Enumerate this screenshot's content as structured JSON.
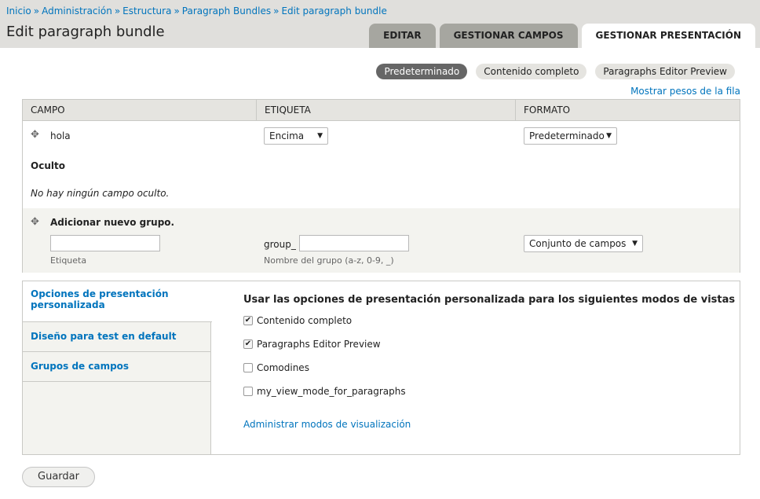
{
  "breadcrumb": [
    "Inicio",
    "Administración",
    "Estructura",
    "Paragraph Bundles",
    "Edit paragraph bundle"
  ],
  "breadcrumb_separator": "»",
  "page_title": "Edit paragraph bundle",
  "tabs": [
    {
      "label": "EDITAR",
      "active": false
    },
    {
      "label": "GESTIONAR CAMPOS",
      "active": false
    },
    {
      "label": "GESTIONAR PRESENTACIÓN",
      "active": true
    }
  ],
  "view_modes": [
    {
      "label": "Predeterminado",
      "active": true
    },
    {
      "label": "Contenido completo",
      "active": false
    },
    {
      "label": "Paragraphs Editor Preview",
      "active": false
    }
  ],
  "show_weights_link": "Mostrar pesos de la fila",
  "table": {
    "headers": [
      "CAMPO",
      "ETIQUETA",
      "FORMATO"
    ],
    "rows": [
      {
        "field": "hola",
        "label_select": "Encima",
        "format_select": "Predeterminado"
      }
    ],
    "hidden_heading": "Oculto",
    "hidden_empty": "No hay ningún campo oculto.",
    "add_group": {
      "label": "Adicionar nuevo grupo.",
      "label_help": "Etiqueta",
      "name_prefix": "group_",
      "name_help": "Nombre del grupo (a-z, 0-9, _)",
      "format_select": "Conjunto de campos"
    }
  },
  "vertical_tabs": [
    {
      "label": "Opciones de presentación personalizada",
      "active": true
    },
    {
      "label": "Diseño para test en default",
      "active": false
    },
    {
      "label": "Grupos de campos",
      "active": false
    }
  ],
  "custom_display": {
    "title": "Usar las opciones de presentación personalizada para los siguientes modos de vistas",
    "options": [
      {
        "label": "Contenido completo",
        "checked": true
      },
      {
        "label": "Paragraphs Editor Preview",
        "checked": true
      },
      {
        "label": "Comodines",
        "checked": false
      },
      {
        "label": "my_view_mode_for_paragraphs",
        "checked": false
      }
    ],
    "manage_link": "Administrar modos de visualización"
  },
  "save_button": "Guardar",
  "icons": {
    "drag": "move-icon",
    "select_caret": "caret-down-icon",
    "check": "checkmark-icon"
  },
  "colors": {
    "link": "#0074bd",
    "header_bg": "#e0dfdc",
    "active_pill": "#666666"
  }
}
